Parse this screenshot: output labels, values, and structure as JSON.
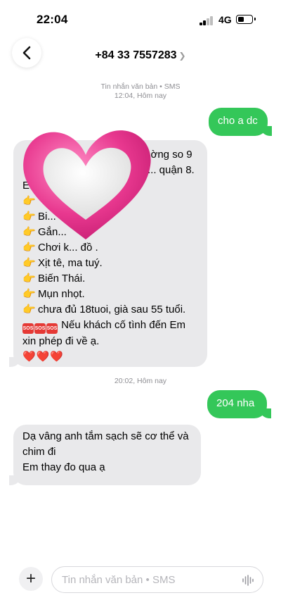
{
  "status_bar": {
    "time": "22:04",
    "network": "4G",
    "icons": [
      "signal-icon",
      "battery-icon"
    ]
  },
  "header": {
    "contact": "+84 33 7557283",
    "back_icon": "chevron-left-icon"
  },
  "thread": {
    "meta_1": {
      "line1": "Tin nhắn văn bản • SMS",
      "line2": "12:04, Hôm nay"
    },
    "msg_1": "cho a dc",
    "msg_2": {
      "lines": [
        "...ờng so 9",
        "... quận 8.",
        "E... ường hợp:",
        "",
        "Bi...",
        "Gắn...",
        "Chơi k... đồ .",
        "Xịt tê, ma tuý.",
        "Biến Thái.",
        "Mụn nhọt.",
        "chưa đủ 18tuoi, già sau 55 tuổi.",
        "Nếu khách cố tình đến Em",
        "xin phép đi về ạ.",
        "❤️❤️❤️"
      ],
      "sos_label": "SOS",
      "pointer_emoji": "👉",
      "overlay": "pink-heart-sticker"
    },
    "meta_2": "20:02, Hôm nay",
    "msg_3": "204 nha",
    "msg_4": {
      "line1": "Dạ vâng anh tắm sạch sẽ cơ thể và",
      "line2": "chim đi",
      "line3": "Em thay đo qua ạ"
    }
  },
  "composer": {
    "placeholder": "Tin nhắn văn bản • SMS",
    "plus_icon": "plus-icon",
    "audio_icon": "waveform-icon"
  },
  "colors": {
    "outgoing": "#34c759",
    "incoming": "#e9e9eb",
    "heart_outer": "#e8388f",
    "heart_inner": "#f2f2f2"
  }
}
